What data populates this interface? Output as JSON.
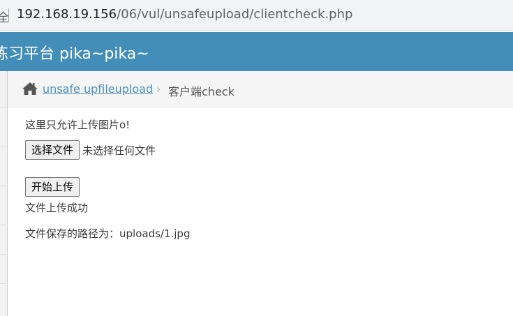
{
  "browser": {
    "address_fragment": "全",
    "url_host": "192.168.19.156",
    "url_path": "/06/vul/unsafeupload/clientcheck.php"
  },
  "header": {
    "title": "练习平台 pika~pika~"
  },
  "breadcrumb": {
    "icon": "home-icon",
    "link_label": "unsafe upfileupload",
    "separator": "›",
    "current": "客户端check"
  },
  "main": {
    "notice": "这里只允许上传图片o!",
    "file_button_label": "选择文件",
    "file_status": "未选择任何文件",
    "upload_button_label": "开始上传",
    "result": "文件上传成功",
    "saved_path": "文件保存的路径为：uploads/1.jpg"
  },
  "colors": {
    "header_bg": "#438eb9",
    "link": "#4c8fbd",
    "breadcrumb_bg": "#f5f5f5"
  }
}
